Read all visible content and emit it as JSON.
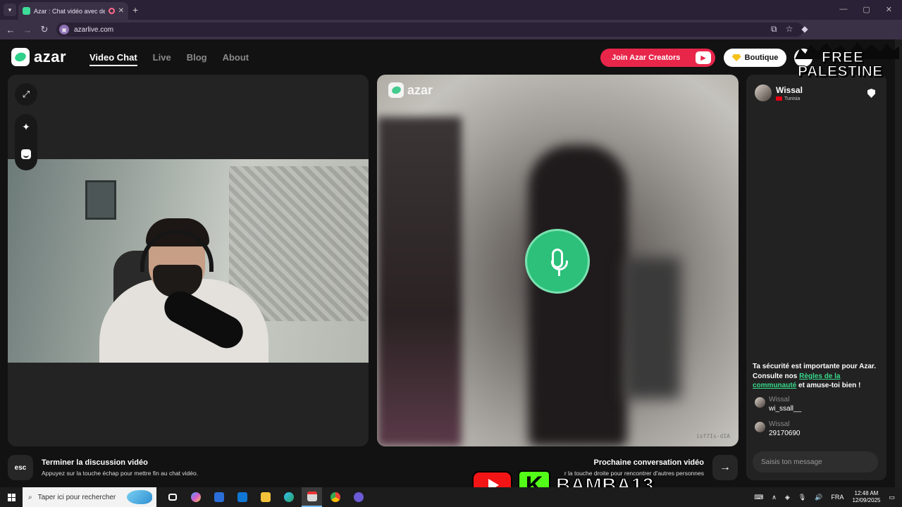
{
  "browser": {
    "tab_title": "Azar : Chat vidéo avec de nouvelles personnes",
    "new_tab": "+",
    "url": "azarlive.com",
    "back": "←",
    "forward": "→",
    "reload": "↻"
  },
  "header": {
    "logo_text": "azar",
    "nav": [
      {
        "label": "Video Chat",
        "active": true
      },
      {
        "label": "Live",
        "active": false
      },
      {
        "label": "Blog",
        "active": false
      },
      {
        "label": "About",
        "active": false
      }
    ],
    "join_label": "Join Azar Creators",
    "boutique_label": "Boutique"
  },
  "overlay": {
    "free_label": "FREE",
    "palestine_label": "PALESTINE",
    "channel_name": "BAMBA13",
    "kick_letter": "K"
  },
  "remote": {
    "logo_text": "azar",
    "watermark": "isf7Is-dIA"
  },
  "chat": {
    "peer_name": "Wissal",
    "peer_country": "Tunisia",
    "safety_text_1": "Ta sécurité est importante pour Azar. Consulte nos ",
    "safety_link": "Règles de la communauté",
    "safety_text_2": " et amuse-toi bien !",
    "messages": [
      {
        "name": "Wissal",
        "text": "wi_ssall__"
      },
      {
        "name": "Wissal",
        "text": "29170690"
      }
    ],
    "input_placeholder": "Saisis ton message"
  },
  "controls": {
    "esc_label": "esc",
    "end_title": "Terminer la discussion vidéo",
    "end_sub": "Appuyez sur la touche échap pour mettre fin au chat vidéo.",
    "next_title": "Prochaine conversation vidéo",
    "next_sub": "r la touche droite pour rencontrer d'autres personnes"
  },
  "taskbar": {
    "search_placeholder": "Taper ici pour rechercher",
    "language": "FRA",
    "time": "12:48 AM",
    "date": "12/09/2025"
  },
  "colors": {
    "accent_green": "#2cc07a",
    "join_red": "#e8264a",
    "link_green": "#37d88a"
  }
}
